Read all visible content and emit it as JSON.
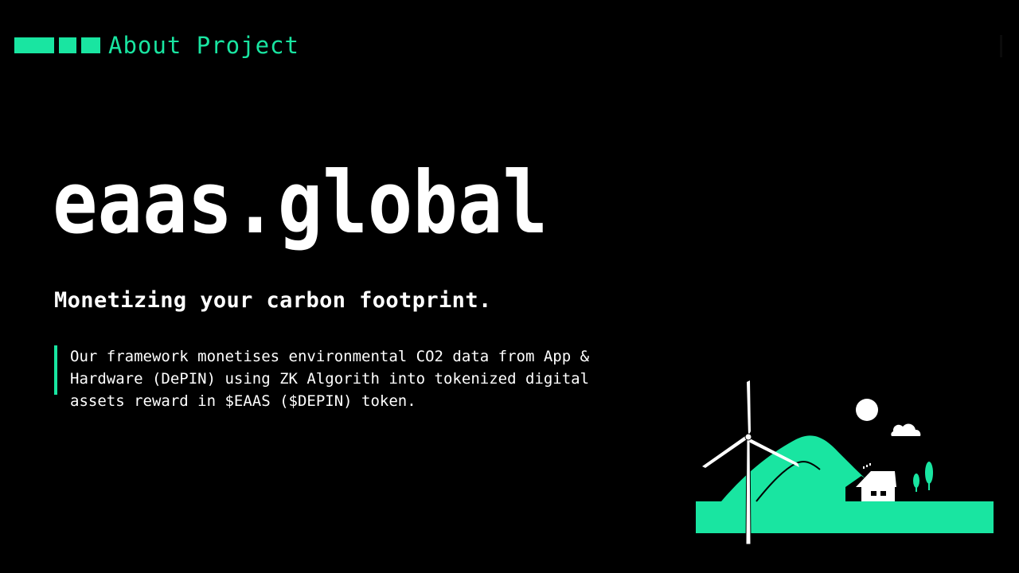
{
  "header": {
    "title": "About Project"
  },
  "logo": {
    "text": "eaas.global"
  },
  "tagline": "Monetizing your carbon footprint.",
  "description": "Our framework monetises environmental CO2 data from App & Hardware (DePIN) using ZK Algorith into tokenized digital assets reward in $EAAS ($DEPIN) token.",
  "colors": {
    "accent": "#19e5a1",
    "background": "#000000",
    "text": "#ffffff"
  },
  "illustration": {
    "icon": "wind-turbine-landscape-icon"
  }
}
